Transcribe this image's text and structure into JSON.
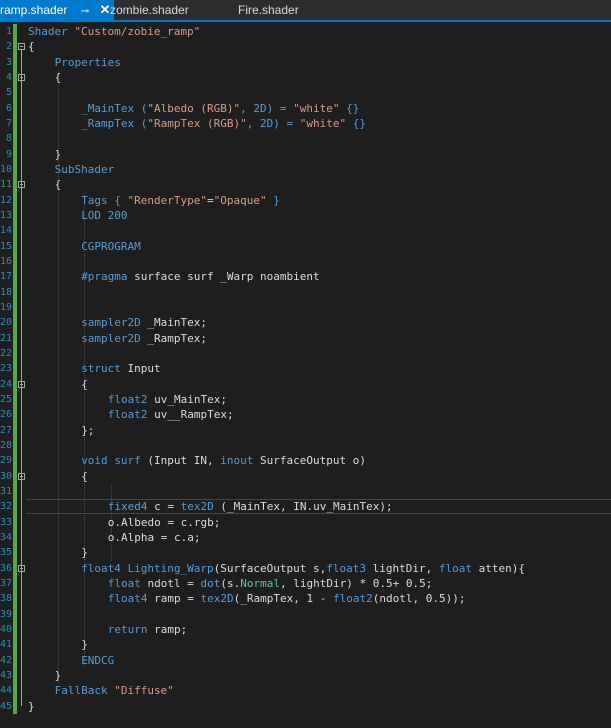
{
  "tabs": [
    {
      "label": "ramp.shader",
      "active": true,
      "pin": "⊸",
      "close": "✕"
    },
    {
      "label": "zombie.shader",
      "active": false
    },
    {
      "label": "Fire.shader",
      "active": false
    }
  ],
  "colors": {
    "keyword": "#569cd6",
    "string": "#d69d85",
    "text": "#dcdcdc",
    "line_number": "#2b91af",
    "change_bar": "#57a64a",
    "active_tab": "#007acc"
  },
  "editor": {
    "current_line": 32,
    "lines": [
      {
        "n": "1",
        "indent": 0,
        "tokens": [
          {
            "t": "Shader ",
            "c": "kw"
          },
          {
            "t": "\"Custom/zobie_ramp\"",
            "c": "str"
          }
        ]
      },
      {
        "n": "2",
        "indent": 0,
        "tokens": [
          {
            "t": "{",
            "c": "plain"
          }
        ]
      },
      {
        "n": "3",
        "indent": 2,
        "tokens": [
          {
            "t": "Properties",
            "c": "kw"
          }
        ]
      },
      {
        "n": "4",
        "indent": 2,
        "tokens": [
          {
            "t": "{",
            "c": "plain"
          }
        ]
      },
      {
        "n": "5",
        "indent": 0,
        "tokens": []
      },
      {
        "n": "6",
        "indent": 4,
        "tokens": [
          {
            "t": "_MainTex (",
            "c": "kw"
          },
          {
            "t": "\"Albedo (RGB)\"",
            "c": "str"
          },
          {
            "t": ", 2D) = ",
            "c": "kw"
          },
          {
            "t": "\"white\"",
            "c": "str"
          },
          {
            "t": " {}",
            "c": "kw"
          }
        ]
      },
      {
        "n": "7",
        "indent": 4,
        "tokens": [
          {
            "t": "_RampTex (",
            "c": "kw"
          },
          {
            "t": "\"RampTex (RGB)\"",
            "c": "str"
          },
          {
            "t": ", 2D) = ",
            "c": "kw"
          },
          {
            "t": "\"white\"",
            "c": "str"
          },
          {
            "t": " {}",
            "c": "kw"
          }
        ]
      },
      {
        "n": "8",
        "indent": 0,
        "tokens": []
      },
      {
        "n": "9",
        "indent": 2,
        "tokens": [
          {
            "t": "}",
            "c": "plain"
          }
        ]
      },
      {
        "n": "10",
        "indent": 2,
        "tokens": [
          {
            "t": "SubShader",
            "c": "kw"
          }
        ]
      },
      {
        "n": "11",
        "indent": 2,
        "tokens": [
          {
            "t": "{",
            "c": "plain"
          }
        ]
      },
      {
        "n": "12",
        "indent": 4,
        "tokens": [
          {
            "t": "Tags { ",
            "c": "kw"
          },
          {
            "t": "\"RenderType\"",
            "c": "str"
          },
          {
            "t": "=",
            "c": "plain"
          },
          {
            "t": "\"Opaque\"",
            "c": "str"
          },
          {
            "t": " }",
            "c": "kw"
          }
        ]
      },
      {
        "n": "13",
        "indent": 4,
        "tokens": [
          {
            "t": "LOD 200",
            "c": "kw"
          }
        ]
      },
      {
        "n": "14",
        "indent": 0,
        "tokens": []
      },
      {
        "n": "15",
        "indent": 4,
        "tokens": [
          {
            "t": "CGPROGRAM",
            "c": "kw"
          }
        ]
      },
      {
        "n": "16",
        "indent": 0,
        "tokens": []
      },
      {
        "n": "17",
        "indent": 4,
        "tokens": [
          {
            "t": "#pragma",
            "c": "kw"
          },
          {
            "t": " surface surf _Warp noambient",
            "c": "plain"
          }
        ]
      },
      {
        "n": "18",
        "indent": 0,
        "tokens": []
      },
      {
        "n": "19",
        "indent": 0,
        "tokens": []
      },
      {
        "n": "20",
        "indent": 4,
        "tokens": [
          {
            "t": "sampler2D",
            "c": "kw"
          },
          {
            "t": " _MainTex;",
            "c": "plain"
          }
        ]
      },
      {
        "n": "21",
        "indent": 4,
        "tokens": [
          {
            "t": "sampler2D",
            "c": "kw"
          },
          {
            "t": " _RampTex;",
            "c": "plain"
          }
        ]
      },
      {
        "n": "22",
        "indent": 0,
        "tokens": []
      },
      {
        "n": "23",
        "indent": 4,
        "tokens": [
          {
            "t": "struct",
            "c": "kw"
          },
          {
            "t": " Input",
            "c": "plain"
          }
        ]
      },
      {
        "n": "24",
        "indent": 4,
        "tokens": [
          {
            "t": "{",
            "c": "plain"
          }
        ]
      },
      {
        "n": "25",
        "indent": 6,
        "tokens": [
          {
            "t": "float2",
            "c": "kw"
          },
          {
            "t": " uv_MainTex;",
            "c": "plain"
          }
        ]
      },
      {
        "n": "26",
        "indent": 6,
        "tokens": [
          {
            "t": "float2",
            "c": "kw"
          },
          {
            "t": " uv__RampTex;",
            "c": "plain"
          }
        ]
      },
      {
        "n": "27",
        "indent": 4,
        "tokens": [
          {
            "t": "};",
            "c": "plain"
          }
        ]
      },
      {
        "n": "28",
        "indent": 0,
        "tokens": []
      },
      {
        "n": "29",
        "indent": 4,
        "tokens": [
          {
            "t": "void",
            "c": "kw"
          },
          {
            "t": " ",
            "c": "plain"
          },
          {
            "t": "surf",
            "c": "kw"
          },
          {
            "t": " (Input IN, ",
            "c": "plain"
          },
          {
            "t": "inout",
            "c": "kw"
          },
          {
            "t": " SurfaceOutput o)",
            "c": "plain"
          }
        ]
      },
      {
        "n": "30",
        "indent": 4,
        "tokens": [
          {
            "t": "{",
            "c": "plain"
          }
        ]
      },
      {
        "n": "31",
        "indent": 0,
        "tokens": []
      },
      {
        "n": "32",
        "indent": 6,
        "tokens": [
          {
            "t": "fixed4",
            "c": "kw"
          },
          {
            "t": " c = ",
            "c": "plain"
          },
          {
            "t": "tex2D",
            "c": "kw"
          },
          {
            "t": " (_MainTex, IN.uv_MainTex);",
            "c": "plain"
          }
        ]
      },
      {
        "n": "33",
        "indent": 6,
        "tokens": [
          {
            "t": "o.Albedo = c.rgb;",
            "c": "plain"
          }
        ]
      },
      {
        "n": "34",
        "indent": 6,
        "tokens": [
          {
            "t": "o.Alpha = c.a;",
            "c": "plain"
          }
        ]
      },
      {
        "n": "35",
        "indent": 4,
        "tokens": [
          {
            "t": "}",
            "c": "plain"
          }
        ]
      },
      {
        "n": "36",
        "indent": 4,
        "tokens": [
          {
            "t": "float4",
            "c": "kw"
          },
          {
            "t": " ",
            "c": "plain"
          },
          {
            "t": "Lighting_Warp",
            "c": "kw"
          },
          {
            "t": "(SurfaceOutput s,",
            "c": "plain"
          },
          {
            "t": "float3",
            "c": "kw"
          },
          {
            "t": " lightDir, ",
            "c": "plain"
          },
          {
            "t": "float",
            "c": "kw"
          },
          {
            "t": " atten){",
            "c": "plain"
          }
        ]
      },
      {
        "n": "37",
        "indent": 6,
        "tokens": [
          {
            "t": "float",
            "c": "kw"
          },
          {
            "t": " ndotl = ",
            "c": "plain"
          },
          {
            "t": "dot",
            "c": "kw"
          },
          {
            "t": "(s.",
            "c": "plain"
          },
          {
            "t": "Normal",
            "c": "prop"
          },
          {
            "t": ", lightDir) * 0.5+ 0.5;",
            "c": "plain"
          }
        ]
      },
      {
        "n": "38",
        "indent": 6,
        "tokens": [
          {
            "t": "float4",
            "c": "kw"
          },
          {
            "t": " ramp = ",
            "c": "plain"
          },
          {
            "t": "tex2D",
            "c": "kw"
          },
          {
            "t": "(_RampTex, 1 - ",
            "c": "plain"
          },
          {
            "t": "float2",
            "c": "kw"
          },
          {
            "t": "(ndotl, 0.5));",
            "c": "plain"
          }
        ]
      },
      {
        "n": "39",
        "indent": 0,
        "tokens": []
      },
      {
        "n": "40",
        "indent": 6,
        "tokens": [
          {
            "t": "return",
            "c": "kw"
          },
          {
            "t": " ramp;",
            "c": "plain"
          }
        ]
      },
      {
        "n": "41",
        "indent": 4,
        "tokens": [
          {
            "t": "}",
            "c": "plain"
          }
        ]
      },
      {
        "n": "42",
        "indent": 4,
        "tokens": [
          {
            "t": "ENDCG",
            "c": "kw"
          }
        ]
      },
      {
        "n": "43",
        "indent": 2,
        "tokens": [
          {
            "t": "}",
            "c": "plain"
          }
        ]
      },
      {
        "n": "44",
        "indent": 2,
        "tokens": [
          {
            "t": "FallBack ",
            "c": "kw"
          },
          {
            "t": "\"Diffuse\"",
            "c": "str"
          }
        ]
      },
      {
        "n": "45",
        "indent": 0,
        "tokens": [
          {
            "t": "}",
            "c": "plain"
          }
        ]
      }
    ]
  }
}
